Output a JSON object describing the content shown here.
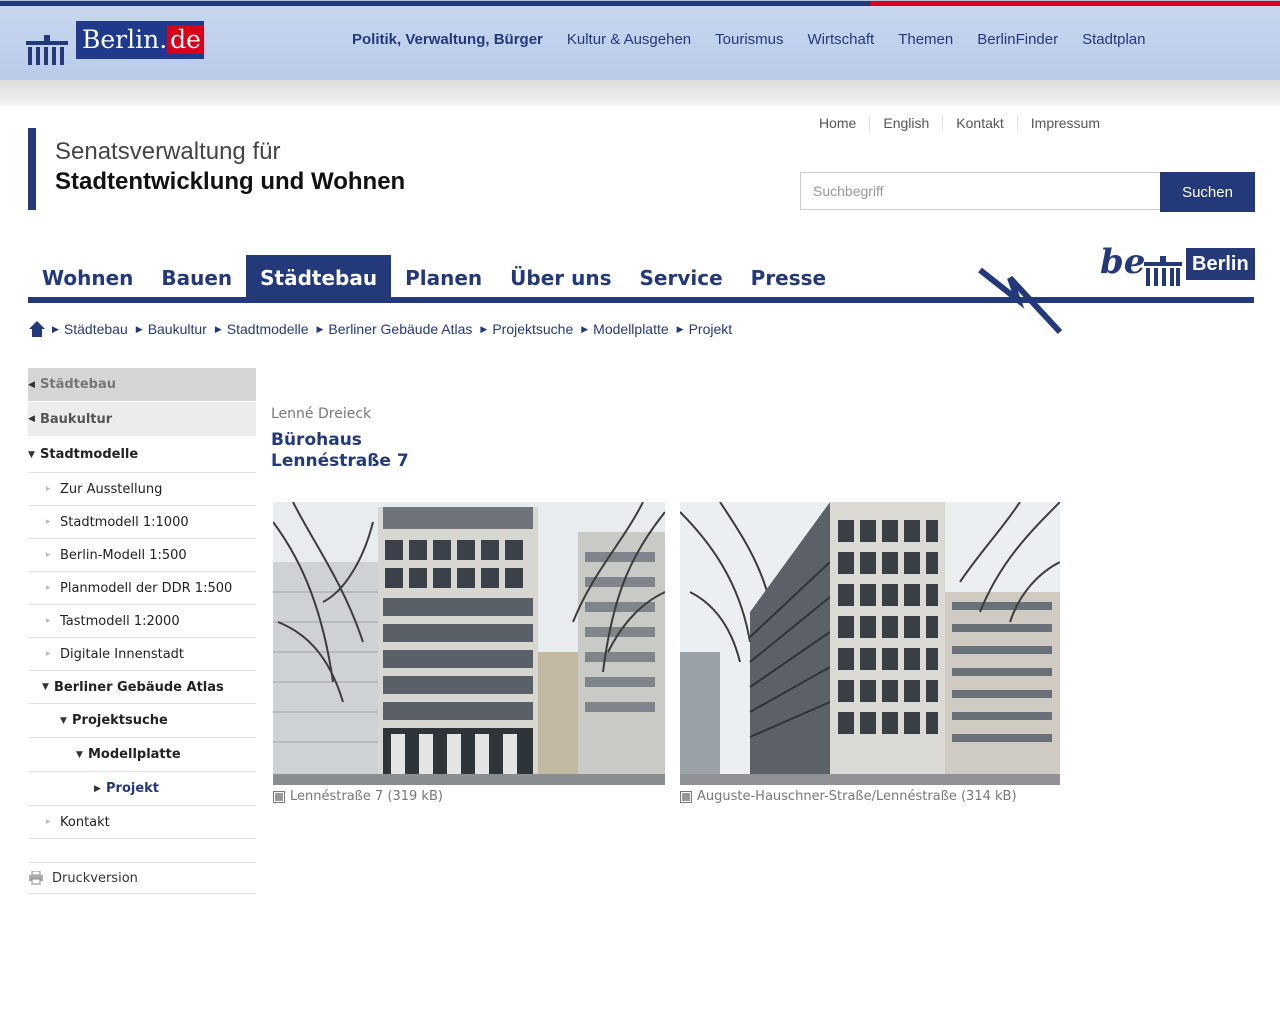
{
  "portal": {
    "logo_text_main": "Berlin",
    "logo_text_dot": ".",
    "logo_text_tld": "de",
    "nav": [
      "Politik, Verwaltung, Bürger",
      "Kultur & Ausgehen",
      "Tourismus",
      "Wirtschaft",
      "Themen",
      "BerlinFinder",
      "Stadtplan"
    ],
    "colors": {
      "blue": "#24397a",
      "red": "#d9001b"
    }
  },
  "header": {
    "org_line1": "Senatsverwaltung für",
    "org_line2": "Stadtentwicklung und Wohnen",
    "service_links": [
      "Home",
      "English",
      "Kontakt",
      "Impressum"
    ],
    "search_placeholder": "Suchbegriff",
    "search_button": "Suchen",
    "campaign_be": "be",
    "campaign_word": "Berlin"
  },
  "main_nav": {
    "items": [
      "Wohnen",
      "Bauen",
      "Städtebau",
      "Planen",
      "Über uns",
      "Service",
      "Presse"
    ],
    "active": "Städtebau"
  },
  "breadcrumb": {
    "home_icon": "home-icon",
    "items": [
      "Städtebau",
      "Baukultur",
      "Stadtmodelle",
      "Berliner Gebäude Atlas",
      "Projektsuche",
      "Modellplatte",
      "Projekt"
    ]
  },
  "sidebar": {
    "top1": "Städtebau",
    "top2": "Baukultur",
    "section": "Stadtmodelle",
    "items": [
      "Zur Ausstellung",
      "Stadtmodell 1:1000",
      "Berlin-Modell 1:500",
      "Planmodell der DDR 1:500",
      "Tastmodell 1:2000",
      "Digitale Innenstadt"
    ],
    "atlas": "Berliner Gebäude Atlas",
    "projektsuche": "Projektsuche",
    "modellplatte": "Modellplatte",
    "projekt": "Projekt",
    "kontakt": "Kontakt",
    "print": "Druckversion"
  },
  "content": {
    "subtitle": "Lenné Dreieck",
    "title_line1": "Bürohaus",
    "title_line2": "Lennéstraße 7",
    "images": [
      {
        "caption": "Lennéstraße 7 (319 kB)"
      },
      {
        "caption": "Auguste-Hauschner-Straße/Lennéstraße (314 kB)"
      }
    ]
  }
}
